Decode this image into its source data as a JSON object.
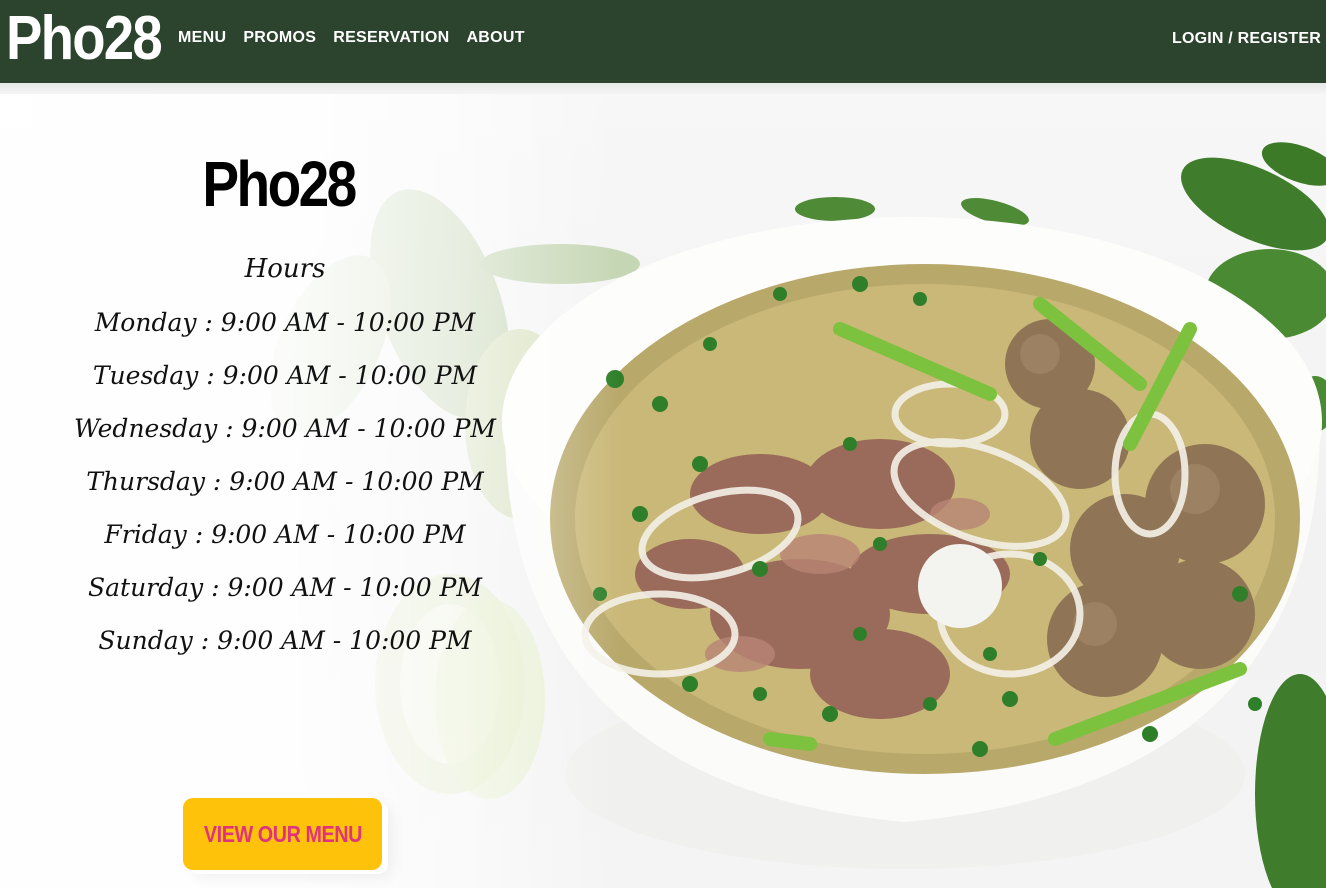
{
  "nav": {
    "brand": "Pho28",
    "links": [
      "MENU",
      "PROMOS",
      "RESERVATION",
      "ABOUT"
    ],
    "login": "LOGIN / REGISTER",
    "background": "#2c432d"
  },
  "hero": {
    "title": "Pho28",
    "hours_title": "Hours",
    "hours": [
      "Monday : 9:00 AM  - 10:00 PM",
      "Tuesday : 9:00 AM  - 10:00 PM",
      "Wednesday : 9:00 AM  - 10:00 PM",
      "Thursday : 9:00 AM  - 10:00 PM",
      "Friday : 9:00 AM  - 10:00 PM",
      "Saturday : 9:00 AM  - 10:00 PM",
      "Sunday : 9:00 AM  - 10:00 PM"
    ],
    "cta_label": "VIEW OUR MENU",
    "cta_color": "#ffc20a",
    "cta_text_color": "#e0337c"
  }
}
